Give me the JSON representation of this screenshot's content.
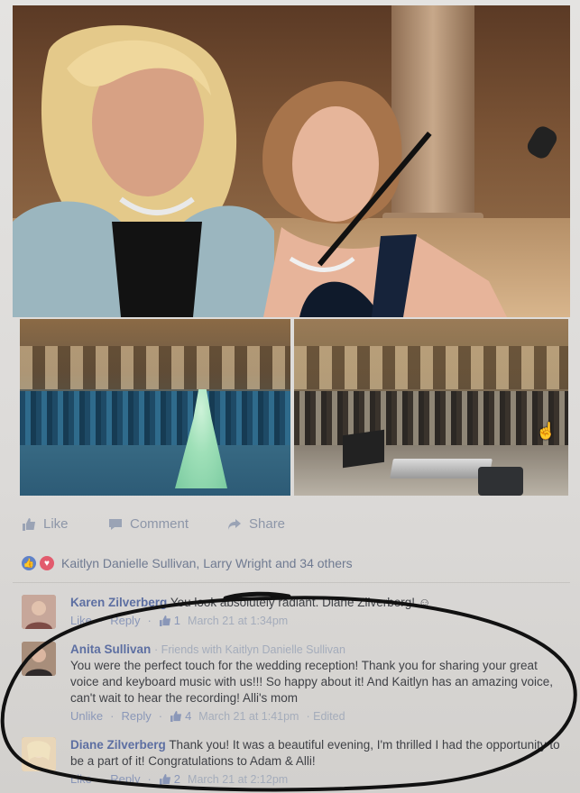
{
  "post": {
    "actions": {
      "like": "Like",
      "comment": "Comment",
      "share": "Share"
    },
    "reactions_text": "Kaitlyn Danielle Sullivan, Larry Wright and 34 others"
  },
  "comments": [
    {
      "name": "Karen Zilverberg",
      "meta": "",
      "text": "You look absolutely radiant. Diane Zilverberg!",
      "emoji": "☺",
      "like": "Like",
      "reply": "Reply",
      "likes": "1",
      "time": "March 21 at 1:34pm",
      "edited": ""
    },
    {
      "name": "Anita Sullivan",
      "meta": "· Friends with Kaitlyn Danielle Sullivan",
      "text": "You were the perfect touch for the wedding reception! Thank you for sharing your great voice and keyboard music with us!!! So happy about it! And Kaitlyn has an amazing voice, can't wait to hear the recording! Alli's mom",
      "like": "Unlike",
      "reply": "Reply",
      "likes": "4",
      "time": "March 21 at 1:41pm",
      "edited": "· Edited"
    },
    {
      "name": "Diane Zilverberg",
      "meta": "",
      "text": "Thank you! It was a beautiful evening, I'm thrilled I had the opportunity to be a part of it! Congratulations to Adam & Alli!",
      "like": "Like",
      "reply": "Reply",
      "likes": "2",
      "time": "March 21 at 2:12pm",
      "edited": ""
    }
  ],
  "colors": {
    "link_blue": "#5d6fa2",
    "action_gray": "#8d96a8",
    "like_blue": "#5f82c8",
    "love_red": "#e25b6d",
    "ink_ellipse": "#111111"
  },
  "icons": [
    "like-thumb-icon",
    "comment-bubble-icon",
    "share-arrow-icon",
    "cursor-hand-icon"
  ]
}
